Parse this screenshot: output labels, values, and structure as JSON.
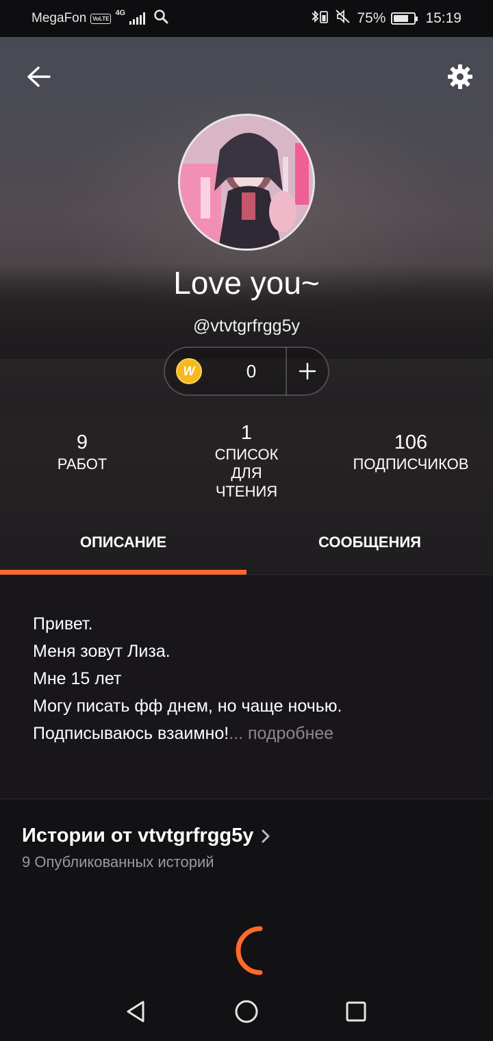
{
  "status_bar": {
    "carrier": "MegaFon",
    "volte": "VoLTE",
    "network": "4G",
    "battery": "75%",
    "battery_level": 0.75,
    "time": "15:19"
  },
  "profile": {
    "display_name": "Love you~",
    "username": "@vtvtgrfrgg5y",
    "coins": "0",
    "coin_icon_letter": "W"
  },
  "stats": [
    {
      "value": "9",
      "label": "РАБОТ"
    },
    {
      "value": "1",
      "label": "СПИСОК ДЛЯ ЧТЕНИЯ"
    },
    {
      "value": "106",
      "label": "ПОДПИСЧИКОВ"
    }
  ],
  "tabs": [
    {
      "label": "ОПИСАНИЕ",
      "active": true
    },
    {
      "label": "СООБЩЕНИЯ",
      "active": false
    }
  ],
  "about": {
    "lines": [
      "Привет.",
      "Меня зовут Лиза.",
      "Мне 15 лет",
      "Могу писать фф днем, но чаще ночью.",
      "Подписываюсь взаимно!"
    ],
    "ellipsis": "...",
    "read_more": "подробнее"
  },
  "stories": {
    "title": "Истории от vtvtgrfrgg5y",
    "subtitle": "9 Опубликованных историй"
  },
  "colors": {
    "accent": "#ff6a2c",
    "coin": "#f6b81c"
  },
  "icons": {
    "back": "arrow-left-icon",
    "settings": "gear-icon",
    "add": "plus-icon",
    "chevron": "chevron-right-icon",
    "loading": "spinner-icon",
    "nav_back": "triangle-back-icon",
    "nav_home": "circle-home-icon",
    "nav_recents": "square-recents-icon"
  }
}
